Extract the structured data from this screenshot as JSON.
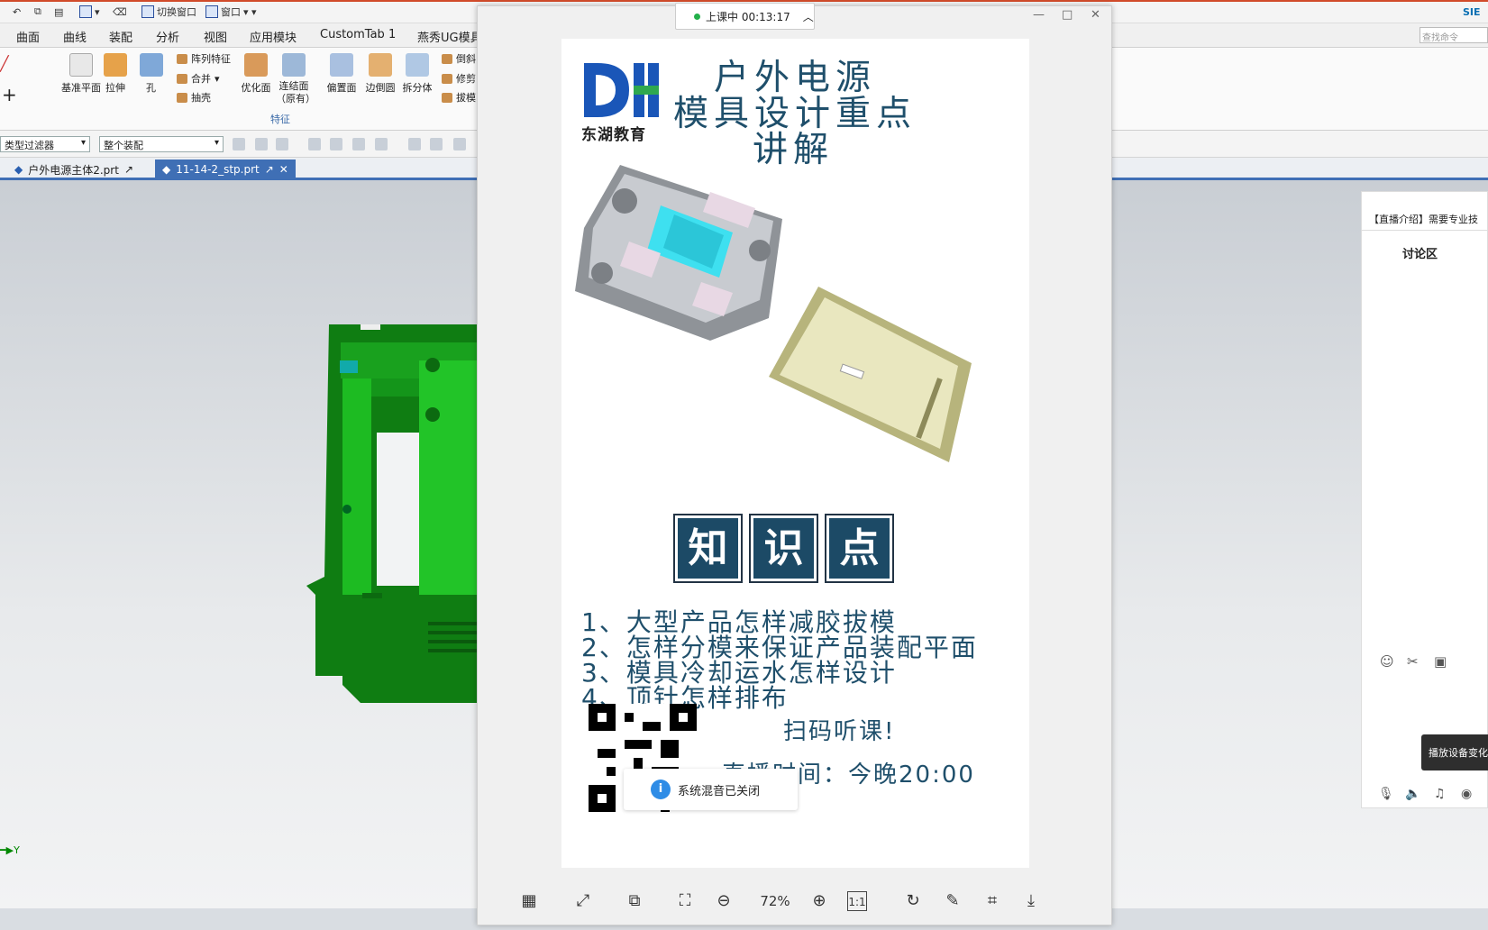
{
  "quickbar": {
    "switch_window": "切换窗口",
    "window": "窗口",
    "brand": "SIE"
  },
  "menu": [
    "曲面",
    "曲线",
    "装配",
    "分析",
    "视图",
    "应用模块",
    "CustomTab 1",
    "燕秀UG模具"
  ],
  "search": {
    "placeholder": "查找命令"
  },
  "ribbon": {
    "datum": "基准平面",
    "extrude": "拉伸",
    "hole": "孔",
    "pattern": "阵列特征",
    "unite": "合并",
    "shell": "抽壳",
    "optimize": "优化面",
    "linked": "连结面（原有）",
    "offset": "偏置面",
    "edge_blend": "边倒圆",
    "split": "拆分体",
    "chamfer": "倒斜",
    "trim": "修剪",
    "draft": "拔模",
    "group": "特征"
  },
  "filters": {
    "filter": "类型过滤器",
    "scope": "整个装配"
  },
  "tabs": [
    {
      "label": "户外电源主体2.prt"
    },
    {
      "label": "11-14-2_stp.prt"
    }
  ],
  "axis": "Y",
  "live": {
    "status": "上课中 00:13:17"
  },
  "poster": {
    "logo_text": "东湖教育",
    "title1": "户外电源",
    "title2": "模具设计重点",
    "title3": "讲解",
    "k1": "知",
    "k2": "识",
    "k3": "点",
    "points": [
      "1、大型产品怎样减胶拔模",
      "2、怎样分模来保证产品装配平面",
      "3、模具冷却运水怎样设计",
      "4、顶针怎样排布"
    ],
    "scan": "扫码听课!",
    "time": "直播时间：今晚20:00"
  },
  "toast": "系统混音已关闭",
  "viewer": {
    "zoom": "72%",
    "ratio": "1:1"
  },
  "side": {
    "intro": "【直播介绍】需要专业技",
    "discussion": "讨论区",
    "tooltip": "播放设备变化"
  }
}
